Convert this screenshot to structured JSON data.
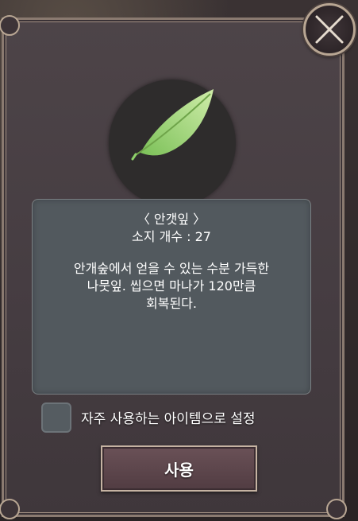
{
  "item": {
    "name": "〈 안갯잎 〉",
    "count_label": "소지 개수 : 27",
    "description": "안개숲에서 얻을 수 있는 수분 가득한\n나뭇잎. 씹으면 마나가 120만큼\n회복된다.",
    "icon": "leaf-icon"
  },
  "favorite_checkbox": {
    "label": "자주 사용하는 아이템으로 설정",
    "checked": false
  },
  "use_button": {
    "label": "사용"
  },
  "colors": {
    "leaf": "#a8e07a",
    "frame": "#b8a693",
    "panel": "#52595e"
  }
}
